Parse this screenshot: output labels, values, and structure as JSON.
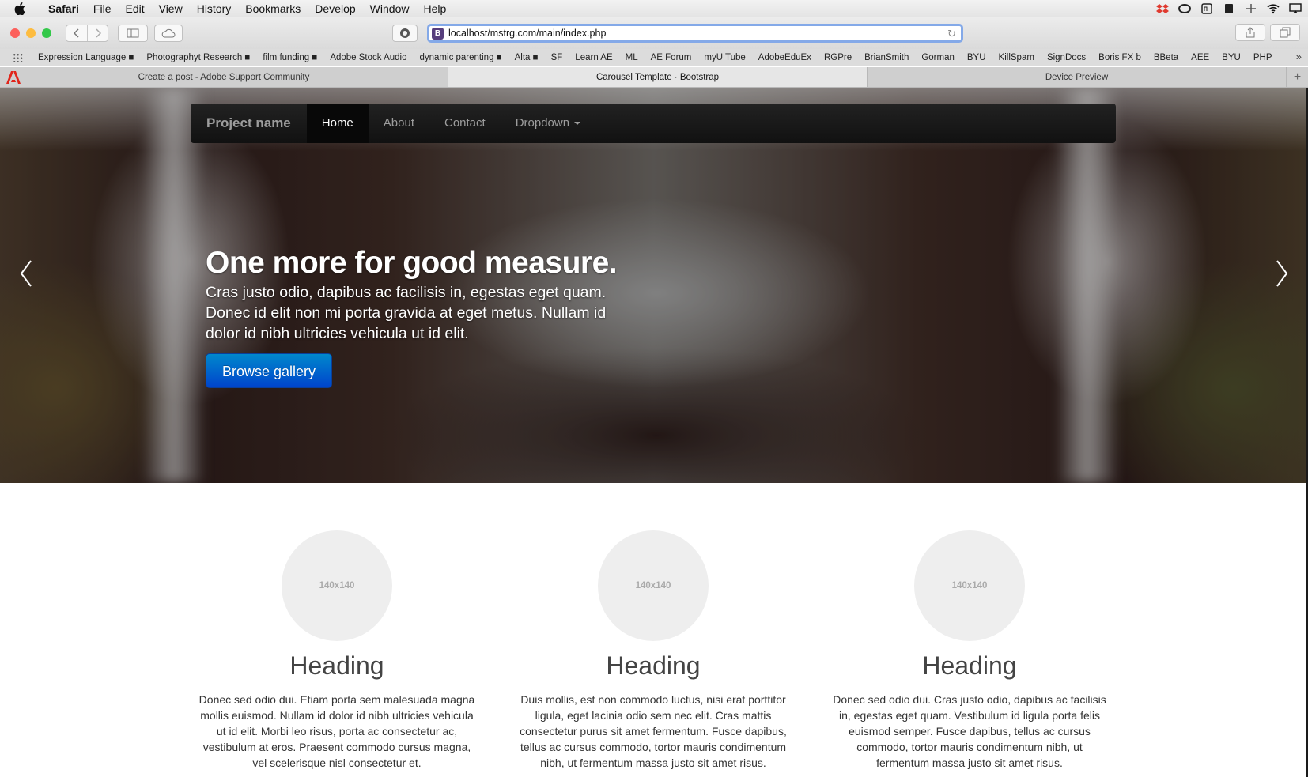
{
  "menubar": {
    "app": "Safari",
    "items": [
      "File",
      "Edit",
      "View",
      "History",
      "Bookmarks",
      "Develop",
      "Window",
      "Help"
    ]
  },
  "toolbar": {
    "url": "localhost/mstrg.com/main/index.php",
    "favicon_letter": "B"
  },
  "bookmarks": [
    "Expression Language ■",
    "Photographyt Research ■",
    "film funding ■",
    "Adobe Stock Audio",
    "dynamic parenting ■",
    "Alta ■",
    "SF",
    "Learn AE",
    "ML",
    "AE Forum",
    "myU Tube",
    "AdobeEduEx",
    "RGPre",
    "BrianSmith",
    "Gorman",
    "BYU",
    "KillSpam",
    "SignDocs",
    "Boris FX b",
    "BBeta",
    "AEE",
    "BYU",
    "PHP"
  ],
  "tabs": [
    {
      "label": "Create a post - Adobe Support Community",
      "active": false
    },
    {
      "label": "Carousel Template · Bootstrap",
      "active": true
    },
    {
      "label": "Device Preview",
      "active": false
    }
  ],
  "navbar": {
    "brand": "Project name",
    "items": [
      "Home",
      "About",
      "Contact",
      "Dropdown"
    ],
    "active": "Home"
  },
  "carousel": {
    "heading": "One more for good measure.",
    "text": "Cras justo odio, dapibus ac facilisis in, egestas eget quam. Donec id elit non mi porta gravida at eget metus. Nullam id dolor id nibh ultricies vehicula ut id elit.",
    "button": "Browse gallery"
  },
  "marketing": [
    {
      "placeholder": "140x140",
      "heading": "Heading",
      "text": "Donec sed odio dui. Etiam porta sem malesuada magna mollis euismod. Nullam id dolor id nibh ultricies vehicula ut id elit. Morbi leo risus, porta ac consectetur ac, vestibulum at eros. Praesent commodo cursus magna, vel scelerisque nisl consectetur et."
    },
    {
      "placeholder": "140x140",
      "heading": "Heading",
      "text": "Duis mollis, est non commodo luctus, nisi erat porttitor ligula, eget lacinia odio sem nec elit. Cras mattis consectetur purus sit amet fermentum. Fusce dapibus, tellus ac cursus commodo, tortor mauris condimentum nibh, ut fermentum massa justo sit amet risus."
    },
    {
      "placeholder": "140x140",
      "heading": "Heading",
      "text": "Donec sed odio dui. Cras justo odio, dapibus ac facilisis in, egestas eget quam. Vestibulum id ligula porta felis euismod semper. Fusce dapibus, tellus ac cursus commodo, tortor mauris condimentum nibh, ut fermentum massa justo sit amet risus."
    }
  ],
  "colors": {
    "traffic_close": "#fc605c",
    "traffic_min": "#fdbc40",
    "traffic_max": "#34c84a",
    "cta_blue": "#0055cc",
    "navbar_bg": "#1b1b1b"
  }
}
